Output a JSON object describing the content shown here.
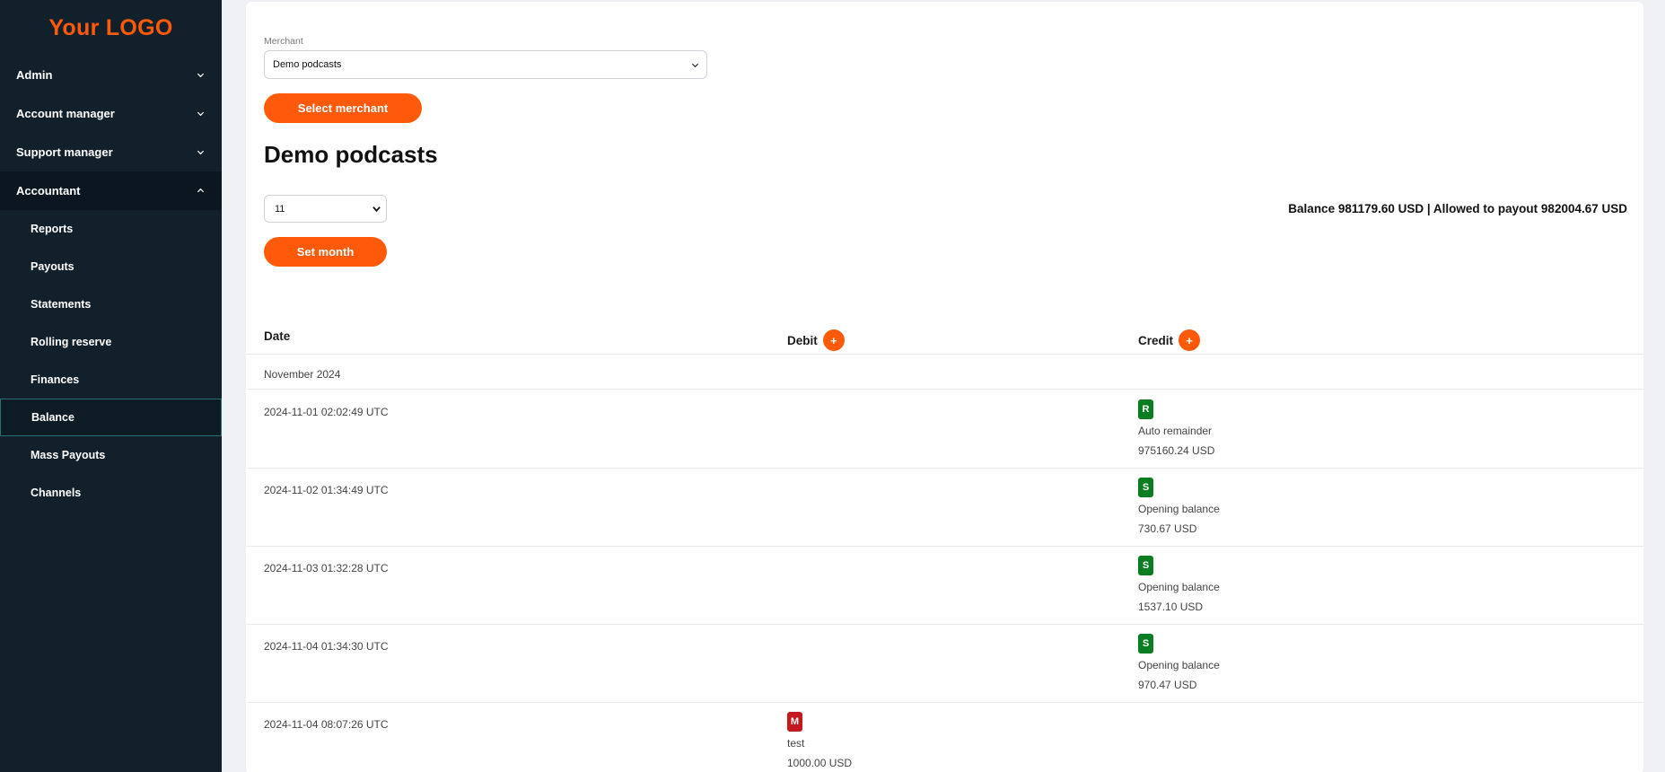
{
  "logo": "Your LOGO",
  "sidebar": {
    "groups": [
      {
        "label": "Admin"
      },
      {
        "label": "Account manager"
      },
      {
        "label": "Support manager"
      },
      {
        "label": "Accountant"
      }
    ],
    "items": [
      {
        "label": "Reports"
      },
      {
        "label": "Payouts"
      },
      {
        "label": "Statements"
      },
      {
        "label": "Rolling reserve"
      },
      {
        "label": "Finances"
      },
      {
        "label": "Balance"
      },
      {
        "label": "Mass Payouts"
      },
      {
        "label": "Channels"
      }
    ]
  },
  "merchant": {
    "label": "Merchant",
    "selected": "Demo podcasts",
    "button": "Select merchant"
  },
  "page_title": "Demo podcasts",
  "month": {
    "selected": "11",
    "button": "Set month"
  },
  "balance_text": "Balance 981179.60 USD | Allowed to payout 982004.67 USD",
  "table": {
    "headers": {
      "date": "Date",
      "debit": "Debit",
      "credit": "Credit",
      "add": "+"
    },
    "month_label": "November 2024",
    "rows": [
      {
        "date": "2024-11-01 02:02:49 UTC",
        "badge": "R",
        "desc": "Auto remainder",
        "amount": "975160.24 USD"
      },
      {
        "date": "2024-11-02 01:34:49 UTC",
        "badge": "S",
        "desc": "Opening balance",
        "amount": "730.67 USD"
      },
      {
        "date": "2024-11-03 01:32:28 UTC",
        "badge": "S",
        "desc": "Opening balance",
        "amount": "1537.10 USD"
      },
      {
        "date": "2024-11-04 01:34:30 UTC",
        "badge": "S",
        "desc": "Opening balance",
        "amount": "970.47 USD"
      },
      {
        "date": "2024-11-04 08:07:26 UTC",
        "badge": "M",
        "desc": "test",
        "amount": "1000.00 USD"
      }
    ]
  },
  "colors": {
    "accent": "#ff5a0a",
    "sidebar_bg": "#12202b",
    "credit_badge": "#0a7d22",
    "debit_badge": "#c4191d"
  }
}
